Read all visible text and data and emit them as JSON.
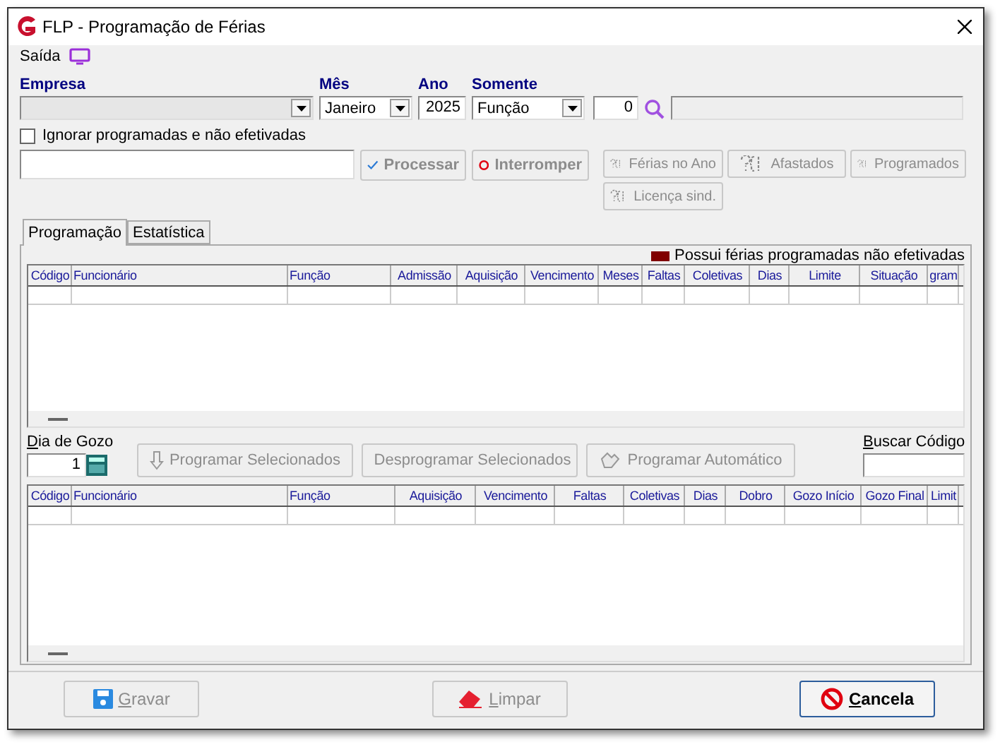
{
  "window": {
    "title": "FLP - Programação de Férias"
  },
  "menu": [
    {
      "label": "Saída"
    }
  ],
  "filters": {
    "empresa": {
      "label": "Empresa"
    },
    "mes": {
      "label": "Mês",
      "value": "Janeiro"
    },
    "ano": {
      "label": "Ano",
      "value": "2025"
    },
    "somente": {
      "label": "Somente",
      "value": "Função",
      "code": "0"
    }
  },
  "ignore_checkbox": {
    "label": "Ignorar programadas e não efetivadas",
    "checked": false
  },
  "actions": [
    {
      "kind": "process",
      "label": "Processar",
      "disabled": true
    },
    {
      "kind": "stop",
      "label": "Interromper",
      "disabled": true
    }
  ],
  "queries": [
    {
      "label": "Férias no Ano",
      "disabled": true
    },
    {
      "label": "Afastados",
      "disabled": true
    },
    {
      "label": "Programados",
      "disabled": true
    },
    {
      "label": "Licença sind.",
      "disabled": true
    }
  ],
  "tabs": [
    {
      "label": "Programação",
      "selected": true
    },
    {
      "label": "Estatística",
      "selected": false
    }
  ],
  "legend": {
    "label": "Possui férias programadas não efetivadas",
    "color": "#800000"
  },
  "grid_top": {
    "columns": [
      "Código",
      "Funcionário",
      "Função",
      "Admissão",
      "Aquisição",
      "Vencimento",
      "Meses",
      "Faltas",
      "Coletivas",
      "Dias",
      "Limite",
      "Situação",
      "gram"
    ]
  },
  "dia_de_gozo": {
    "label": "Dia de Gozo",
    "value": "1"
  },
  "schedule_buttons": [
    {
      "kind": "down",
      "label": "Programar Selecionados",
      "disabled": true
    },
    {
      "kind": "up",
      "label": "Desprogramar Selecionados",
      "disabled": true
    },
    {
      "kind": "auto",
      "label": "Programar Automático",
      "disabled": true
    }
  ],
  "buscar_codigo": {
    "label": "Buscar Código"
  },
  "grid_bottom": {
    "columns": [
      "Código",
      "Funcionário",
      "Função",
      "Aquisição",
      "Vencimento",
      "Faltas",
      "Coletivas",
      "Dias",
      "Dobro",
      "Gozo Início",
      "Gozo Final",
      "Limit"
    ]
  },
  "footer": [
    {
      "kind": "save",
      "label": "Gravar",
      "disabled": true
    },
    {
      "kind": "clear",
      "label": "Limpar",
      "disabled": true
    },
    {
      "kind": "cancel",
      "label": "Cancela",
      "disabled": false
    }
  ]
}
